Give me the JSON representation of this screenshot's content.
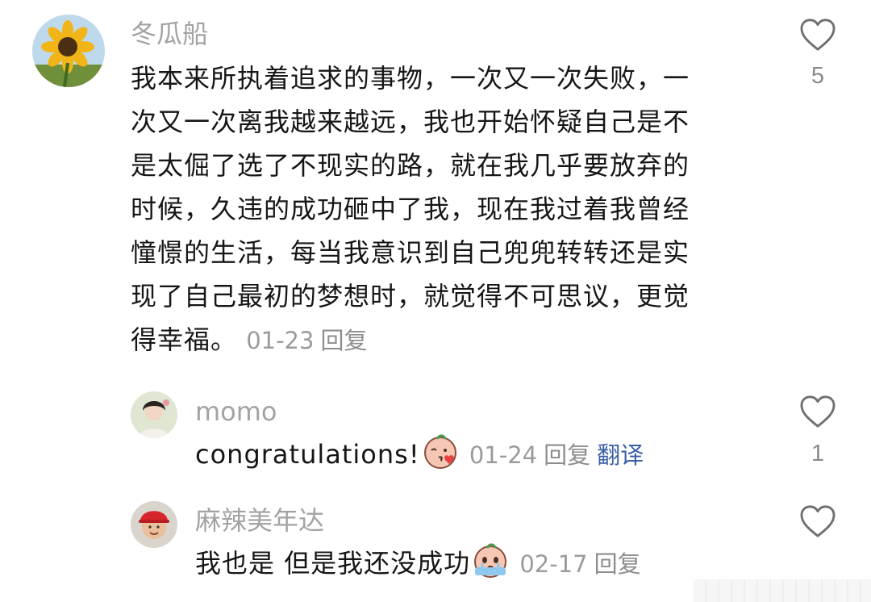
{
  "comments": [
    {
      "author": "冬瓜船",
      "lines": [
        "我本来所执着追求的事物，一次又一次失败，一",
        "次又一次离我越来越远，我也开始怀疑自己是不",
        "是太倔了选了不现实的路，就在我几乎要放弃的",
        "时候，久违的成功砸中了我，现在我过着我曾经",
        "憧憬的生活，每当我意识到自己兜兜转转还是实",
        "现了自己最初的梦想时，就觉得不可思议，更觉",
        "得幸福。"
      ],
      "date": "01-23",
      "reply_label": "回复",
      "like_count": "5",
      "avatar_icon": "sunflower-avatar"
    },
    {
      "author": "momo",
      "text": "congratulations!",
      "emoji_icon": "kiss-face-emoji",
      "date": "01-24",
      "reply_label": "回复",
      "translate_label": "翻译",
      "like_count": "1",
      "avatar_icon": "girl-photo-avatar"
    },
    {
      "author": "麻辣美年达",
      "text": "我也是 但是我还没成功",
      "emoji_icon": "crying-face-emoji",
      "date": "02-17",
      "reply_label": "回复",
      "avatar_icon": "boy-red-cap-avatar"
    }
  ],
  "colors": {
    "name": "#a3a3a3",
    "text": "#161616",
    "meta": "#9b9b9b",
    "link": "#3b5fa6"
  }
}
